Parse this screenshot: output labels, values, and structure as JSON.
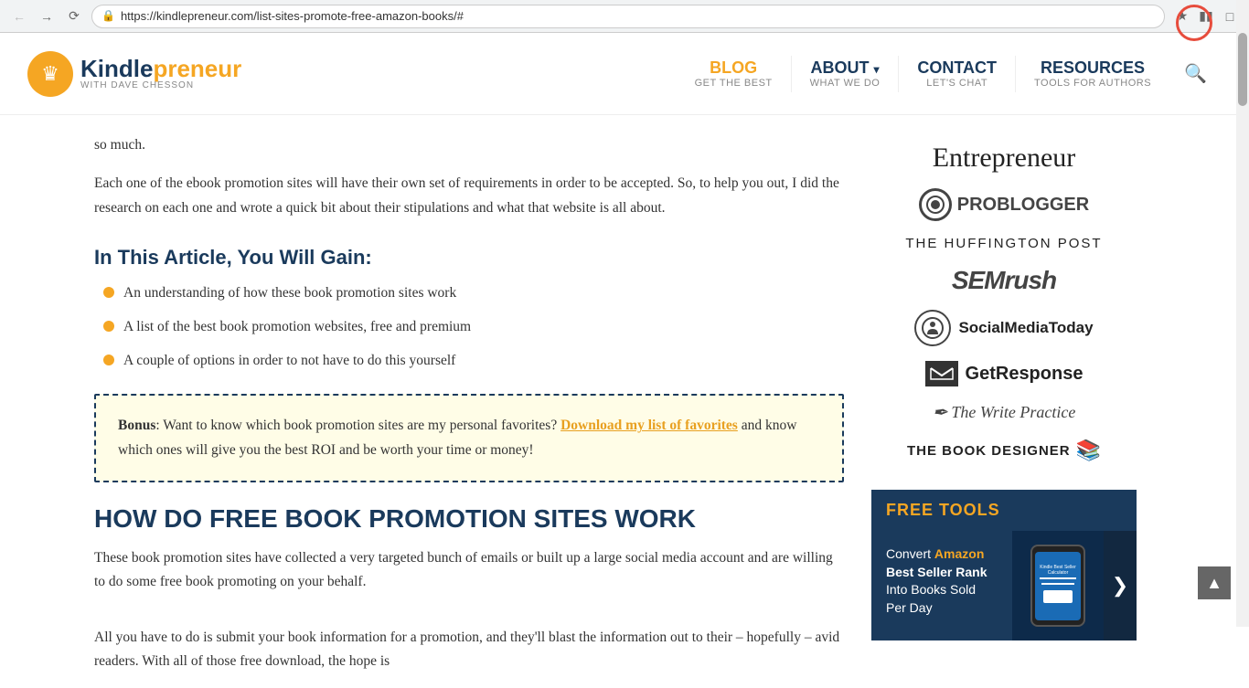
{
  "browser": {
    "url": "https://kindlepreneur.com/list-sites-promote-free-amazon-books/#",
    "secure_label": "Secure"
  },
  "header": {
    "logo_kindle": "Kindle",
    "logo_preneur": "preneur",
    "logo_subtitle": "WITH DAVE CHESSON",
    "nav": [
      {
        "label": "BLOG",
        "sublabel": "GET THE BEST",
        "style": "blog"
      },
      {
        "label": "ABOUT",
        "sublabel": "WHAT WE DO",
        "style": "about",
        "has_arrow": true
      },
      {
        "label": "CONTACT",
        "sublabel": "LET'S CHAT",
        "style": "contact"
      },
      {
        "label": "RESOURCES",
        "sublabel": "TOOLS FOR AUTHORS",
        "style": "resources"
      }
    ]
  },
  "article": {
    "intro_text": "so much.",
    "body_para": "Each one of the ebook promotion sites will have their own set of requirements in order to be accepted. So, to help you out, I did the research on each one and wrote a quick bit about their stipulations and what that website is all about.",
    "section_h2": "In This Article, You Will Gain:",
    "bullets": [
      "An understanding of how these book promotion sites work",
      "A list of the best book promotion websites, free and premium",
      "A couple of options in order to not have to do this yourself"
    ],
    "bonus_prefix": "Bonus",
    "bonus_text": ": Want to know which book promotion sites are my personal favorites?",
    "bonus_link": "Download my list of favorites",
    "bonus_suffix": "and know which ones will give you the best ROI and be worth your time or money!",
    "section_h3": "HOW DO FREE BOOK PROMOTION SITES WORK",
    "how_para": "These book promotion sites have collected a very targeted bunch of emails or built up a large social media account and are willing to do some free book promoting on your behalf.",
    "all_para": "All you have to do is submit your book information for a promotion, and they'll blast the information out to their – hopefully – avid readers. With all of those free download, the hope is"
  },
  "sidebar": {
    "logos": [
      {
        "name": "Entrepreneur",
        "type": "entrepreneur"
      },
      {
        "name": "PROBLOGGER",
        "type": "problogger"
      },
      {
        "name": "THE HUFFINGTON POST",
        "type": "huffpost"
      },
      {
        "name": "SEMrush",
        "type": "semrush"
      },
      {
        "name": "SocialMediaToday",
        "type": "socialmedia"
      },
      {
        "name": "GetResponse",
        "type": "getresponse"
      },
      {
        "name": "The Write Practice",
        "type": "writepractice"
      },
      {
        "name": "THE BOOK DESIGNER",
        "type": "bookdesigner"
      }
    ],
    "free_tools": {
      "section_title": "FREE TOOLS",
      "card_title_line1": "Convert",
      "card_title_amazon": "Amazon",
      "card_title_line2": "Best Seller Rank",
      "card_title_line3": "Into Books Sold",
      "card_title_line4": "Per Day",
      "arrow": "❯"
    }
  }
}
